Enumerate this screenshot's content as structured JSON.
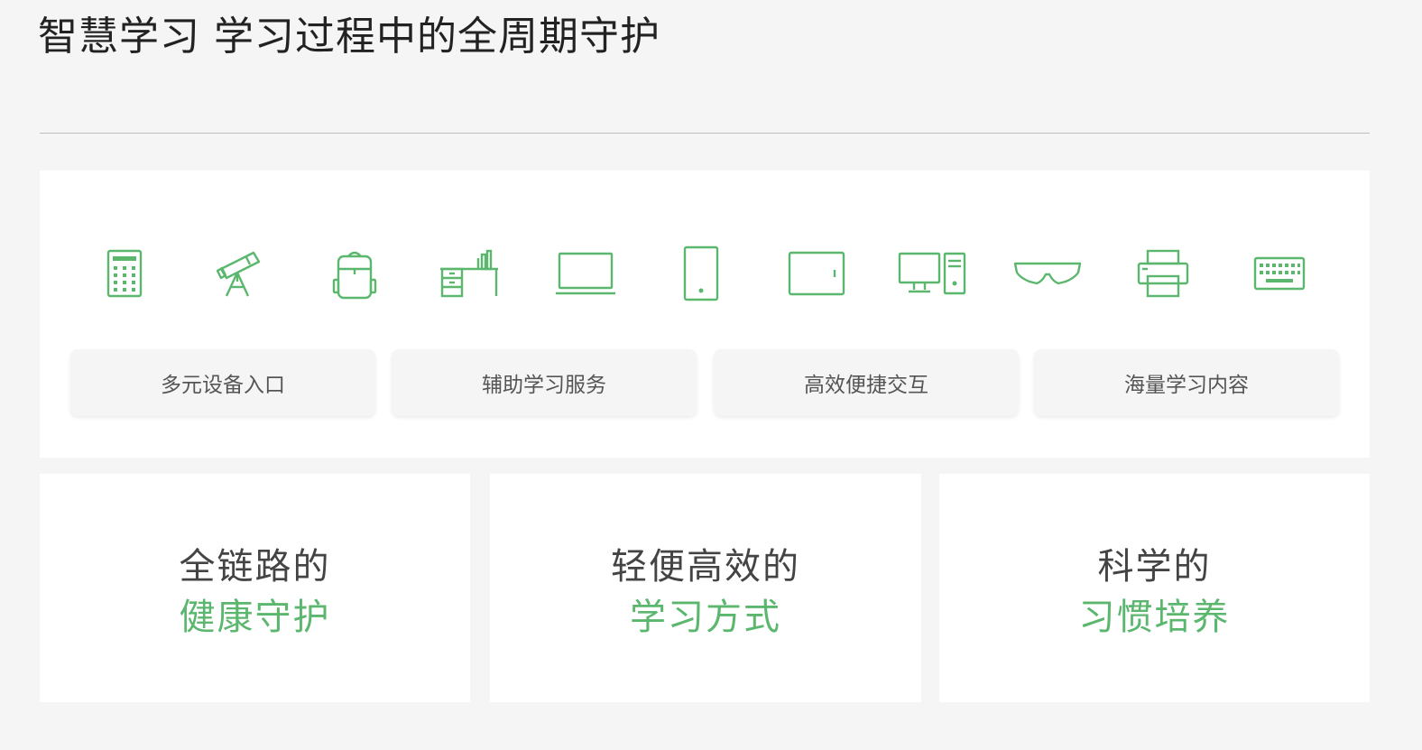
{
  "title": "智慧学习 学习过程中的全周期守护",
  "accent_color": "#5cb76e",
  "devices": [
    {
      "icon": "calculator-icon"
    },
    {
      "icon": "telescope-icon"
    },
    {
      "icon": "backpack-icon"
    },
    {
      "icon": "desk-icon"
    },
    {
      "icon": "laptop-icon"
    },
    {
      "icon": "phone-icon"
    },
    {
      "icon": "tablet-icon"
    },
    {
      "icon": "desktop-computer-icon"
    },
    {
      "icon": "glasses-icon"
    },
    {
      "icon": "printer-icon"
    },
    {
      "icon": "keyboard-icon"
    }
  ],
  "tags": [
    {
      "label": "多元设备入口"
    },
    {
      "label": "辅助学习服务"
    },
    {
      "label": "高效便捷交互"
    },
    {
      "label": "海量学习内容"
    }
  ],
  "features": [
    {
      "line1": "全链路的",
      "line2": "健康守护"
    },
    {
      "line1": "轻便高效的",
      "line2": "学习方式"
    },
    {
      "line1": "科学的",
      "line2": "习惯培养"
    }
  ]
}
